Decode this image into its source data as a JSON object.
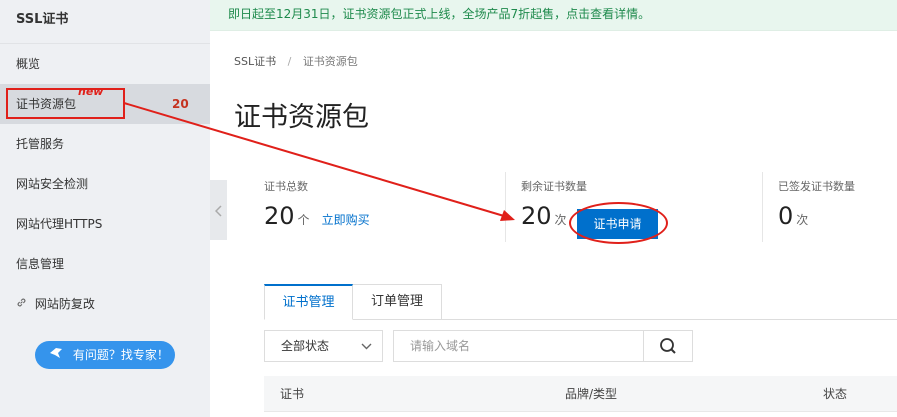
{
  "sidebar": {
    "title": "SSL证书",
    "items": [
      {
        "label": "概览"
      },
      {
        "label": "证书资源包",
        "tag": "new",
        "count": "20"
      },
      {
        "label": "托管服务"
      },
      {
        "label": "网站安全检测"
      },
      {
        "label": "网站代理HTTPS"
      },
      {
        "label": "信息管理"
      },
      {
        "label": "网站防复改"
      }
    ],
    "help_button": "有问题？找专家！"
  },
  "banner": {
    "text": "即日起至12月31日，证书资源包正式上线，全场产品7折起售，点击查看详情。"
  },
  "breadcrumb": {
    "root": "SSL证书",
    "separator": "/",
    "current": "证书资源包"
  },
  "page_title": "证书资源包",
  "stats": {
    "total": {
      "label": "证书总数",
      "value": "20",
      "unit": "个",
      "link": "立即购买"
    },
    "remaining": {
      "label": "剩余证书数量",
      "value": "20",
      "unit": "次",
      "button": "证书申请"
    },
    "issued": {
      "label": "已签发证书数量",
      "value": "0",
      "unit": "次"
    }
  },
  "tabs": [
    {
      "label": "证书管理",
      "active": true
    },
    {
      "label": "订单管理",
      "active": false
    }
  ],
  "filter": {
    "status_value": "全部状态",
    "search_placeholder": "请输入域名"
  },
  "table": {
    "columns": [
      "证书",
      "品牌/类型",
      "状态"
    ]
  },
  "colors": {
    "accent": "#0070cc",
    "annotation_red": "#e0201a",
    "banner_bg": "#e8f6ee",
    "banner_text": "#1e8a4c"
  }
}
